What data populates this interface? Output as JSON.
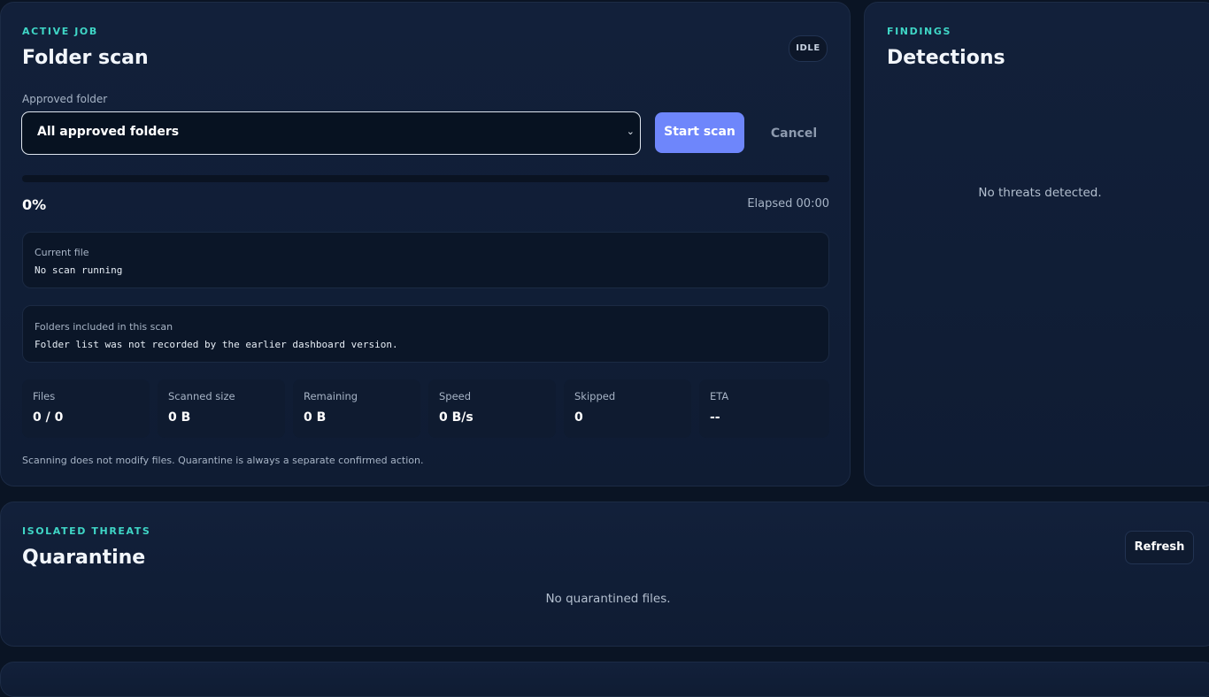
{
  "scan": {
    "eyebrow": "ACTIVE JOB",
    "title": "Folder scan",
    "status_badge": "IDLE",
    "folder_label": "Approved folder",
    "folder_selected": "All approved folders",
    "start_label": "Start scan",
    "cancel_label": "Cancel",
    "progress_pct": "0%",
    "progress_value": 0,
    "elapsed": "Elapsed 00:00",
    "current_file": {
      "label": "Current file",
      "value": "No scan running"
    },
    "folders": {
      "label": "Folders included in this scan",
      "value": "Folder list was not recorded by the earlier dashboard version."
    },
    "stats": [
      {
        "label": "Files",
        "value": "0 / 0"
      },
      {
        "label": "Scanned size",
        "value": "0 B"
      },
      {
        "label": "Remaining",
        "value": "0 B"
      },
      {
        "label": "Speed",
        "value": "0 B/s"
      },
      {
        "label": "Skipped",
        "value": "0"
      },
      {
        "label": "ETA",
        "value": "--"
      }
    ],
    "note": "Scanning does not modify files. Quarantine is always a separate confirmed action."
  },
  "findings": {
    "eyebrow": "FINDINGS",
    "title": "Detections",
    "empty": "No threats detected."
  },
  "quarantine": {
    "eyebrow": "ISOLATED THREATS",
    "title": "Quarantine",
    "refresh_label": "Refresh",
    "empty": "No quarantined files."
  },
  "colors": {
    "accent": "#6e86fb",
    "eyebrow": "#3fd6c6",
    "background": "#0a1424"
  }
}
